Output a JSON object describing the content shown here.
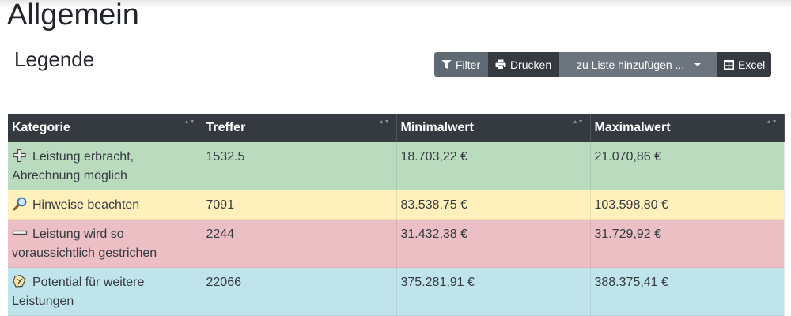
{
  "page": {
    "title": "Allgemein",
    "section_title": "Legende"
  },
  "toolbar": {
    "filter_label": "Filter",
    "print_label": "Drucken",
    "add_to_list_label": "zu Liste hinzufügen ...",
    "excel_label": "Excel"
  },
  "table": {
    "headers": [
      "Kategorie",
      "Treffer",
      "Minimalwert",
      "Maximalwert"
    ],
    "rows": [
      {
        "icon": "plus-icon",
        "color": "#badbbe",
        "category": "Leistung erbracht, Abrechnung möglich",
        "hits": "1532.5",
        "min": "18.703,22 €",
        "max": "21.070,86 €"
      },
      {
        "icon": "magnifier-icon",
        "color": "#fff0bc",
        "category": "Hinweise beachten",
        "hits": "7091",
        "min": "83.538,75 €",
        "max": "103.598,80 €"
      },
      {
        "icon": "minus-icon",
        "color": "#ecbfc4",
        "category": "Leistung wird so voraussichtlich gestrichen",
        "hits": "2244",
        "min": "31.432,38 €",
        "max": "31.729,92 €"
      },
      {
        "icon": "potential-icon",
        "color": "#bfe4eb",
        "category": "Potential für weitere Leistungen",
        "hits": "22066",
        "min": "375.281,91 €",
        "max": "388.375,41 €"
      }
    ]
  }
}
